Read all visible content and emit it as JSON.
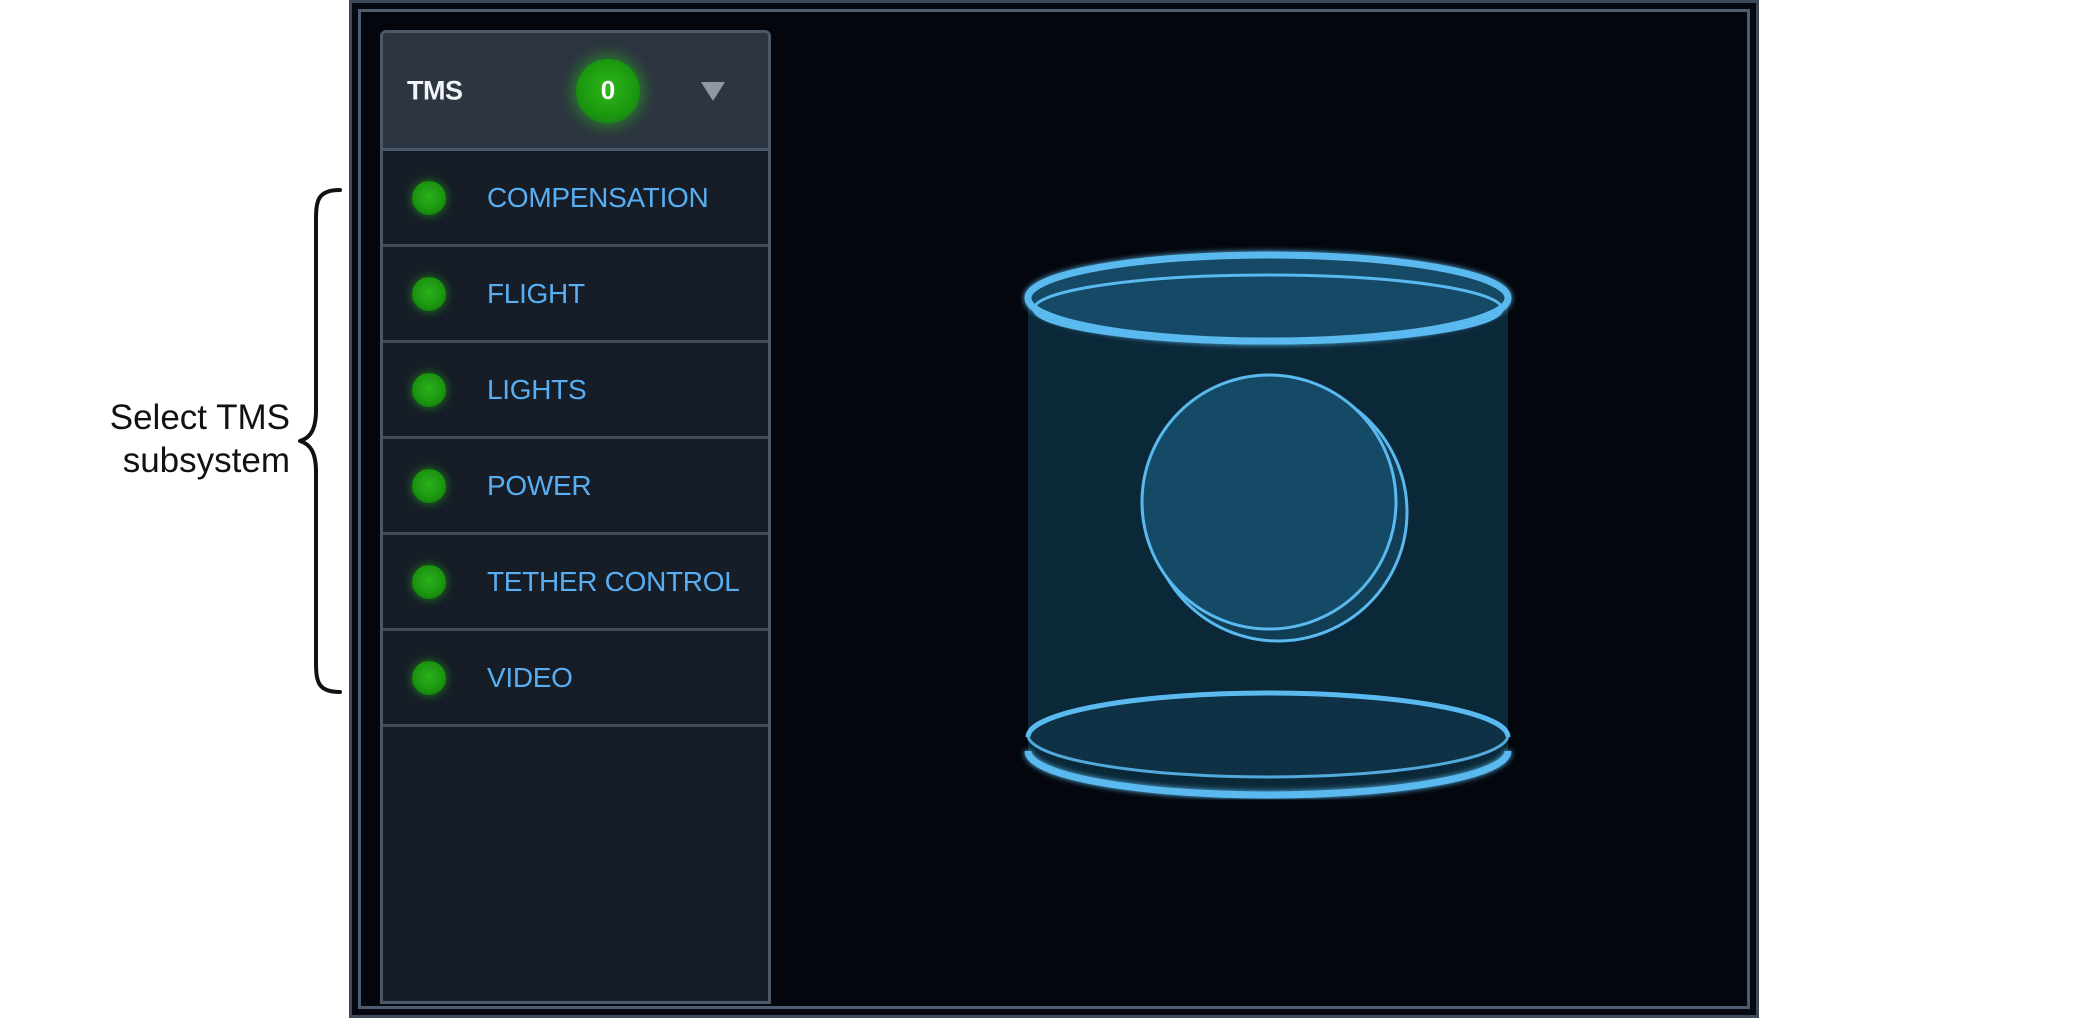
{
  "annotation": {
    "line1": "Select TMS",
    "line2": "subsystem"
  },
  "panel": {
    "title": "TMS",
    "alarm_count": "0",
    "dropdown_icon": "triangle-down-icon"
  },
  "subsystems": [
    {
      "label": "COMPENSATION",
      "status": "ok"
    },
    {
      "label": "FLIGHT",
      "status": "ok"
    },
    {
      "label": "LIGHTS",
      "status": "ok"
    },
    {
      "label": "POWER",
      "status": "ok"
    },
    {
      "label": "TETHER CONTROL",
      "status": "ok"
    },
    {
      "label": "VIDEO",
      "status": "ok"
    }
  ],
  "colors": {
    "status_ok": "#1f9f12",
    "label_text": "#58aef2",
    "model_stroke": "#5ab9ee",
    "model_fill": "#0f3a52",
    "background": "#03060d"
  }
}
